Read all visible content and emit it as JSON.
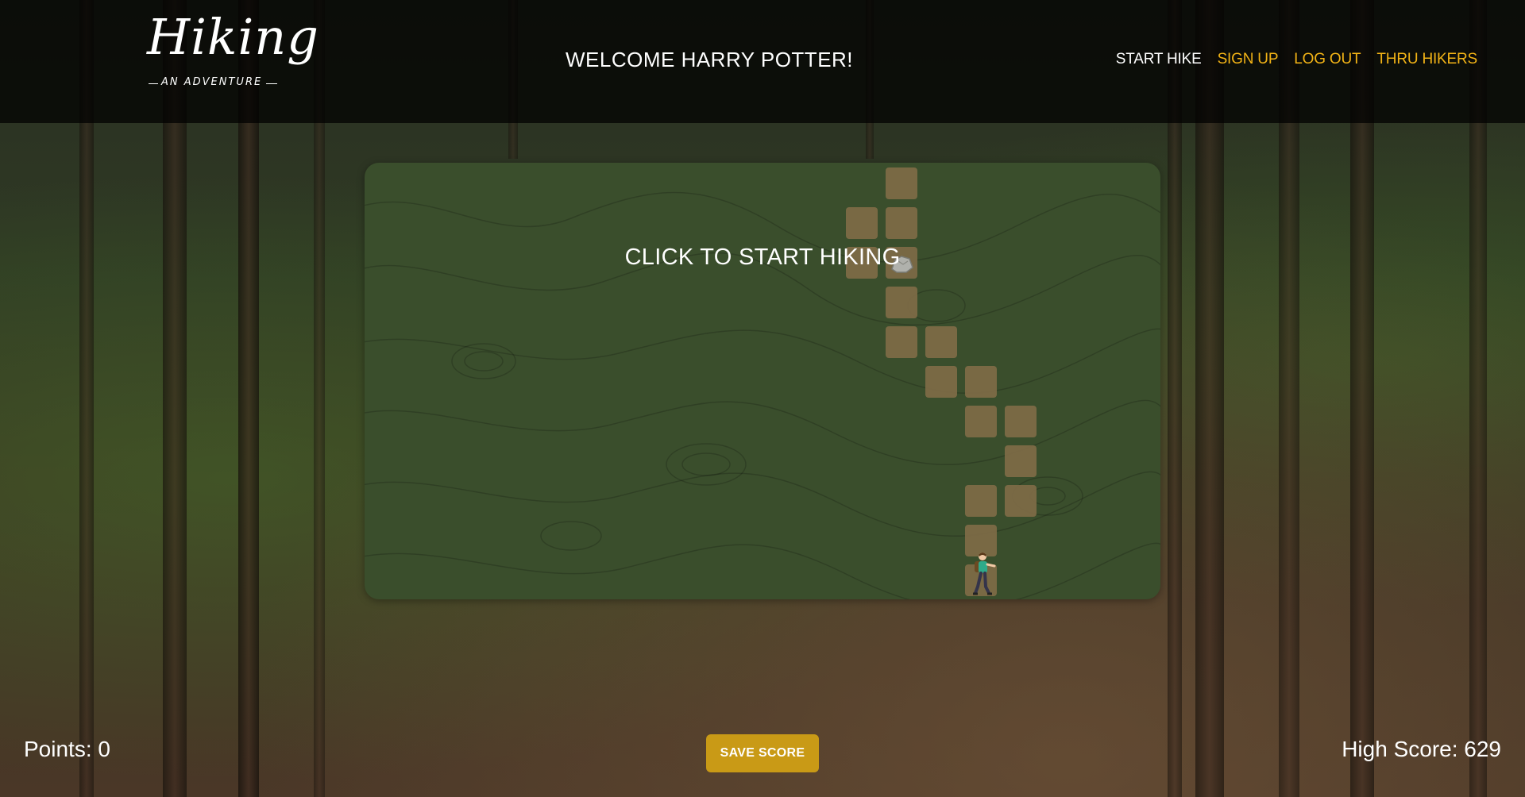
{
  "header": {
    "logo_title": "Hiking",
    "logo_subtitle": "AN ADVENTURE",
    "welcome": "WELCOME HARRY POTTER!"
  },
  "nav": {
    "start_hike": "START HIKE",
    "sign_up": "SIGN UP",
    "log_out": "LOG OUT",
    "thru_hikers": "THRU HIKERS"
  },
  "game": {
    "start_prompt": "CLICK TO START HIKING"
  },
  "footer": {
    "points": "Points: 0",
    "save_score": "SAVE SCORE",
    "high_score": "High Score: 629"
  },
  "colors": {
    "nav_accent": "#f2b316",
    "tile": "#7c6a46",
    "board": "#3a4e2c",
    "save_button": "#c99a16"
  },
  "icons": {
    "rock": "rock-icon",
    "hiker": "hiker-icon"
  }
}
